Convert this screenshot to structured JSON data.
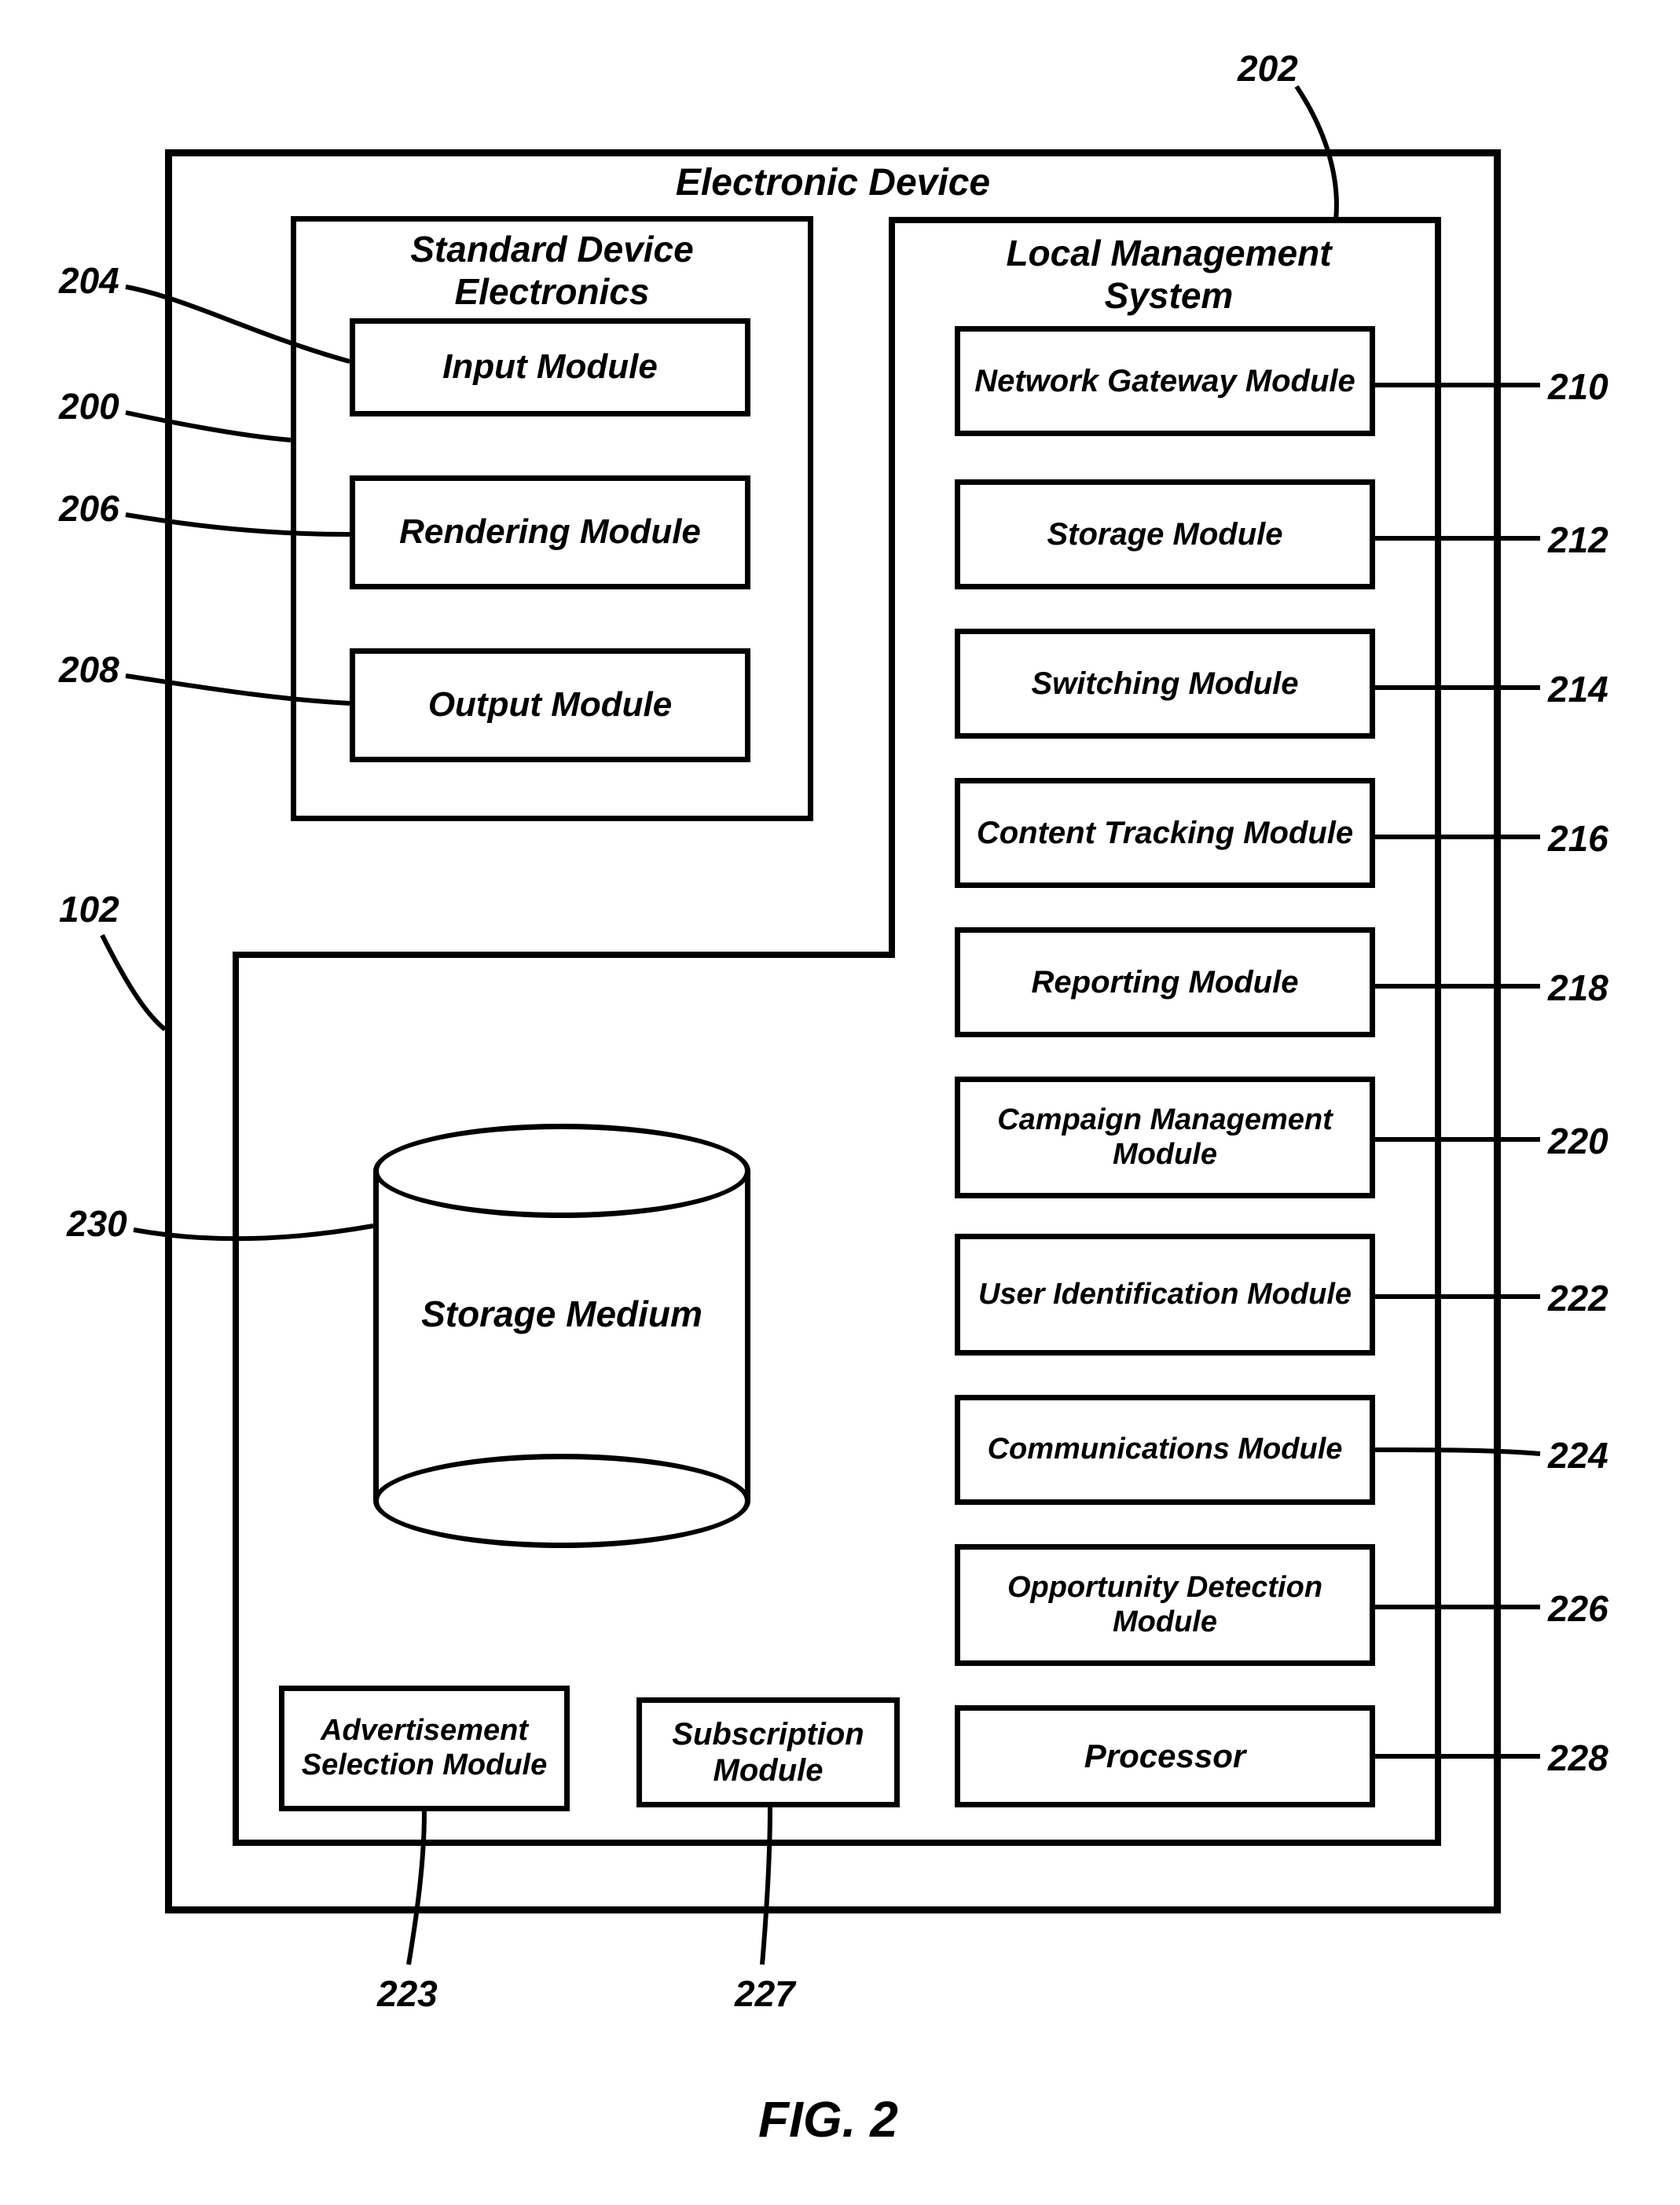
{
  "figure": "FIG. 2",
  "outer": {
    "title": "Electronic Device",
    "ref": "102"
  },
  "sde": {
    "title": "Standard Device Electronics",
    "ref": "200",
    "modules": [
      {
        "label": "Input Module",
        "ref": "204"
      },
      {
        "label": "Rendering Module",
        "ref": "206"
      },
      {
        "label": "Output Module",
        "ref": "208"
      }
    ]
  },
  "lms": {
    "title": "Local Management System",
    "ref": "202",
    "modules": [
      {
        "label": "Network Gateway Module",
        "ref": "210"
      },
      {
        "label": "Storage Module",
        "ref": "212"
      },
      {
        "label": "Switching Module",
        "ref": "214"
      },
      {
        "label": "Content Tracking Module",
        "ref": "216"
      },
      {
        "label": "Reporting Module",
        "ref": "218"
      },
      {
        "label": "Campaign Management Module",
        "ref": "220"
      },
      {
        "label": "User Identification Module",
        "ref": "222"
      },
      {
        "label": "Communications Module",
        "ref": "224"
      },
      {
        "label": "Opportunity Detection Module",
        "ref": "226"
      },
      {
        "label": "Processor",
        "ref": "228"
      }
    ],
    "bottom": [
      {
        "label": "Advertisement Selection Module",
        "ref": "223"
      },
      {
        "label": "Subscription Module",
        "ref": "227"
      }
    ]
  },
  "storage": {
    "label": "Storage Medium",
    "ref": "230"
  }
}
